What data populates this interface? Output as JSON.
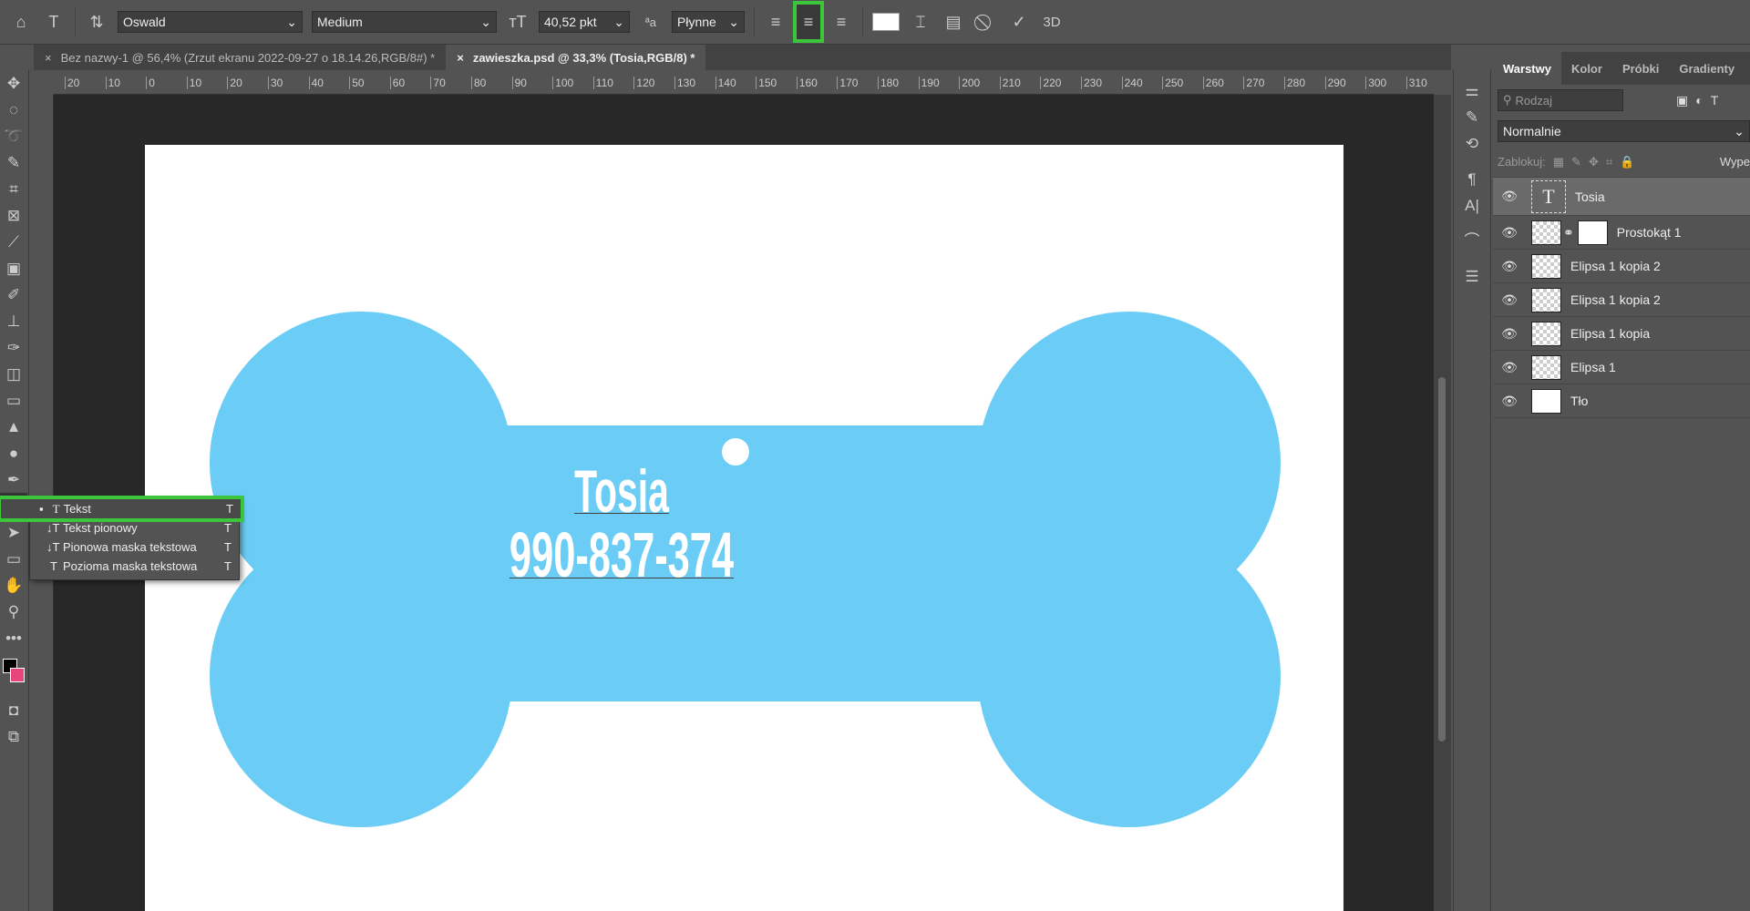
{
  "options_bar": {
    "font_family": "Oswald",
    "font_style": "Medium",
    "font_size": "40,52 pkt",
    "antialias": "Płynne",
    "three_d": "3D",
    "text_color": "#ffffff",
    "align_selected": "center"
  },
  "tabs": [
    {
      "label": "Bez nazwy-1 @ 56,4% (Zrzut ekranu 2022-09-27 o 18.14.26,RGB/8#) *",
      "active": false
    },
    {
      "label": "zawieszka.psd @ 33,3% (Tosia,RGB/8) *",
      "active": true
    }
  ],
  "ruler_ticks": [
    "20",
    "10",
    "0",
    "10",
    "20",
    "30",
    "40",
    "50",
    "60",
    "70",
    "80",
    "90",
    "100",
    "110",
    "120",
    "130",
    "140",
    "150",
    "160",
    "170",
    "180",
    "190",
    "200",
    "210",
    "220",
    "230",
    "240",
    "250",
    "260",
    "270",
    "280",
    "290",
    "300",
    "310"
  ],
  "document": {
    "name": "Tosia",
    "phone": "990-837-374",
    "bone_color": "#6bcdf5"
  },
  "tool_menu": {
    "items": [
      {
        "label": "Tekst",
        "shortcut": "T",
        "selected": true
      },
      {
        "label": "Tekst pionowy",
        "shortcut": "T"
      },
      {
        "label": "Pionowa maska tekstowa",
        "shortcut": "T"
      },
      {
        "label": "Pozioma maska tekstowa",
        "shortcut": "T"
      }
    ]
  },
  "layers_panel": {
    "tabs": [
      "Warstwy",
      "Kolor",
      "Próbki",
      "Gradienty"
    ],
    "search_placeholder": "Rodzaj",
    "blend_mode": "Normalnie",
    "lock_label": "Zablokuj:",
    "fill_label": "Wype",
    "layers": [
      {
        "name": "Tosia",
        "type": "text",
        "selected": true
      },
      {
        "name": "Prostokąt 1",
        "type": "shape-mask"
      },
      {
        "name": "Elipsa 1 kopia 2",
        "type": "shape"
      },
      {
        "name": "Elipsa 1 kopia 2",
        "type": "shape"
      },
      {
        "name": "Elipsa 1 kopia",
        "type": "shape"
      },
      {
        "name": "Elipsa 1",
        "type": "shape"
      },
      {
        "name": "Tło",
        "type": "background"
      }
    ]
  },
  "highlight_color": "#3cc63c"
}
